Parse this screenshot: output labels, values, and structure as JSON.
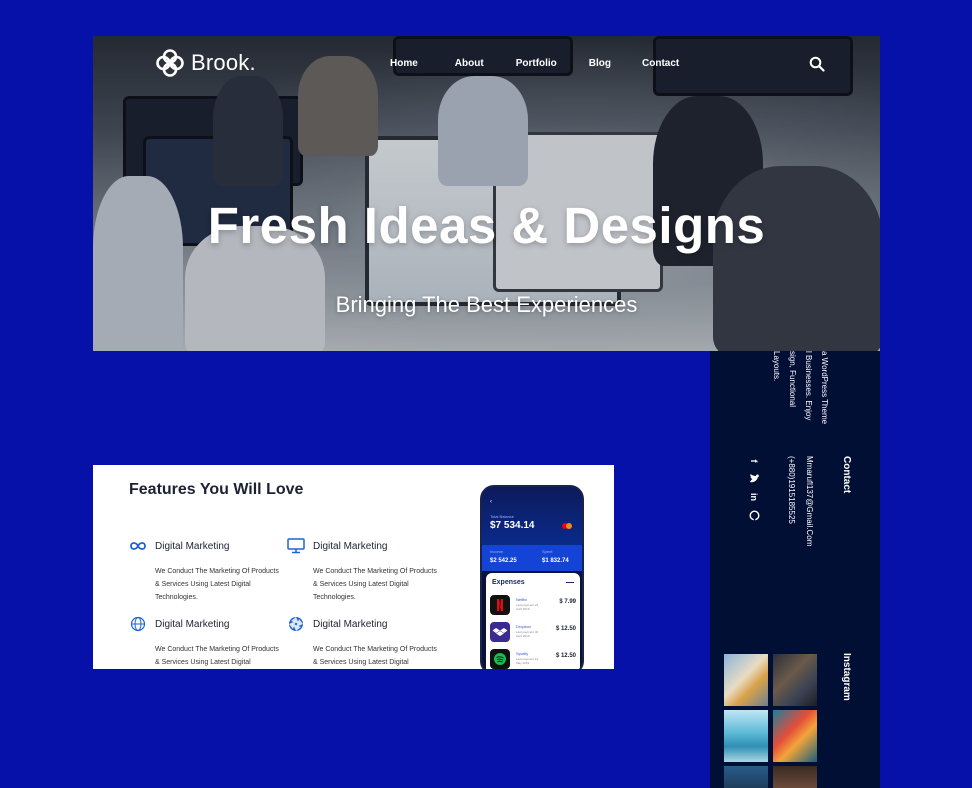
{
  "brand": {
    "name": "Brook."
  },
  "nav": {
    "items": [
      "Home",
      "About",
      "Portfolio",
      "Blog",
      "Contact"
    ]
  },
  "hero": {
    "title": "Fresh Ideas & Designs",
    "subtitle": "Bringing The Best Experiences"
  },
  "features": {
    "title": "Features You Will Love",
    "items": [
      {
        "title": "Digital Marketing",
        "text": "We Conduct The Marketing Of Products & Services Using Latest Digital Technologies.",
        "icon": "infinity-icon"
      },
      {
        "title": "Digital Marketing",
        "text": "We Conduct The Marketing Of Products & Services Using Latest Digital Technologies.",
        "icon": "monitor-icon"
      },
      {
        "title": "Digital Marketing",
        "text": "We Conduct The Marketing Of Products & Services Using Latest Digital Technologies.",
        "icon": "globe-icon"
      },
      {
        "title": "Digital Marketing",
        "text": "We Conduct The Marketing Of Products & Services Using Latest Digital Technologies.",
        "icon": "aperture-icon"
      }
    ]
  },
  "phone": {
    "total_label": "Total Balance",
    "total": "$7 534.14",
    "income_label": "Income",
    "income": "$2 542.25",
    "spent_label": "Spent",
    "spent": "$1 832.74",
    "expenses_title": "Expenses",
    "expenses": [
      {
        "name": "Netflix",
        "sub": "Last payment 23 April 2019",
        "value": "$ 7.99",
        "color": "#111111"
      },
      {
        "name": "Dropbox",
        "sub": "Last payment 30 April 2019",
        "value": "$ 12.50",
        "color": "#3b2a8f"
      },
      {
        "name": "Spotify",
        "sub": "Last payment 14 May 2019",
        "value": "$ 12.50",
        "color": "#111111"
      }
    ]
  },
  "footer": {
    "desc_lines": [
      "a WordPress Theme",
      "l Businesses. Enjoy",
      "sign, Functional",
      "Layouts."
    ],
    "contact_heading": "Contact",
    "email": "Mmarufl137@Gmail.Com",
    "phone": "(+880)1915185525",
    "instagram_heading": "Instagram"
  },
  "colors": {
    "page_bg": "#0511a8",
    "footer_bg": "#020f35",
    "accent": "#1344d6"
  }
}
